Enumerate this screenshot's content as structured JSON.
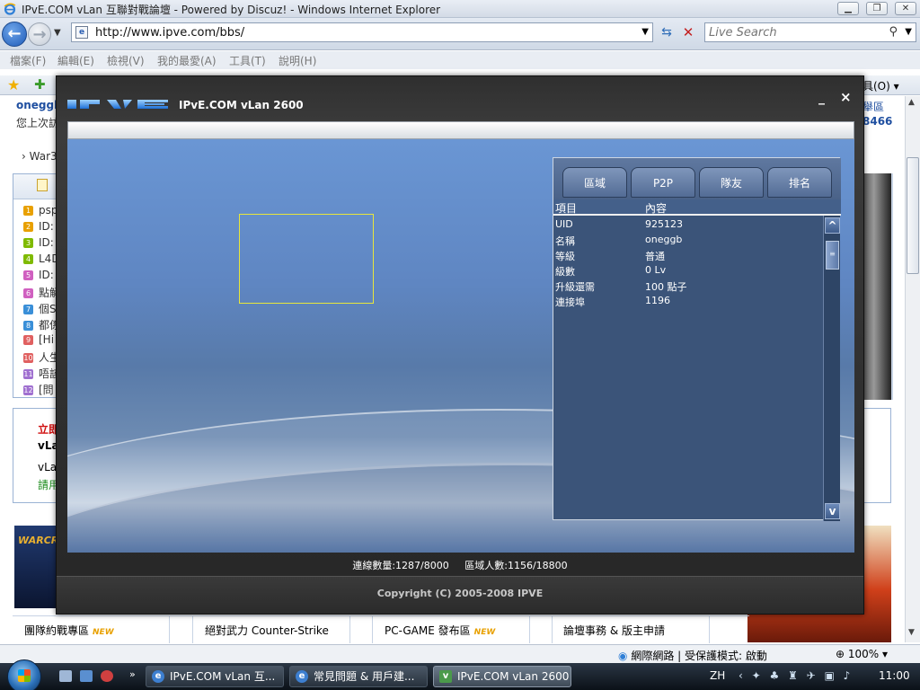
{
  "browser": {
    "window_title": "IPvE.COM vLan 互聯對戰論壇 - Powered by Discuz! - Windows Internet Explorer",
    "url": "http://www.ipve.com/bbs/",
    "search_placeholder": "Live Search",
    "menu": [
      "檔案(F)",
      "編輯(E)",
      "檢視(V)",
      "我的最愛(A)",
      "工具(T)",
      "說明(H)"
    ],
    "tools_label": "具(O)",
    "status_zone": "網際網路 | 受保護模式: 啟動",
    "zoom": "100%"
  },
  "webpage": {
    "username": "oneggb",
    "last_visit": "您上次訪",
    "breadcrumb": "War3",
    "list_items": [
      "psp",
      "ID:",
      "ID:",
      "L4D",
      "ID:",
      "點解",
      "個S",
      "都係",
      "[Hi",
      "人生",
      "唔該",
      "[問"
    ],
    "list_num_colors": [
      "#e8a000",
      "#e8a000",
      "#7fba00",
      "#7fba00",
      "#d060c0",
      "#d060c0",
      "#3a8fd8",
      "#3a8fd8",
      "#e06060",
      "#e06060",
      "#a070d0",
      "#a070d0"
    ],
    "notice_red": "立即",
    "notice_bold": "vLa",
    "notice_text": "vLa",
    "notice_link": "請用",
    "side_link": "舉區",
    "side_number": "8466",
    "bottom_row": [
      "團隊約戰專區",
      "絕對武力 Counter-Strike",
      "PC-GAME 發布區",
      "論壇事務 & 版主申請"
    ],
    "new_label": "NEW"
  },
  "taskbar": {
    "buttons": [
      "IPvE.COM vLan 互...",
      "常見問題 & 用戶建...",
      "IPvE.COM vLan 2600"
    ],
    "lang": "ZH",
    "clock": "11:00"
  },
  "app": {
    "logo_text": "IPVE",
    "title": "IPvE.COM vLan 2600",
    "tabs": [
      "區域",
      "P2P",
      "隊友",
      "排名"
    ],
    "columns": [
      "項目",
      "內容"
    ],
    "rows": [
      {
        "key": "UID",
        "value": "925123"
      },
      {
        "key": "名稱",
        "value": "oneggb"
      },
      {
        "key": "等級",
        "value": "普通"
      },
      {
        "key": "級數",
        "value": "0 Lv"
      },
      {
        "key": "升級還需",
        "value": "100 點子"
      },
      {
        "key": "連接埠",
        "value": "1196"
      }
    ],
    "status_connections": "連線數量:1287/8000",
    "status_region": "區域人數:1156/18800",
    "copyright": "Copyright (C) 2005-2008 IPVE"
  },
  "colors": {
    "app_panel_bg": "#3b5479",
    "app_main_blue": "#6a96d4",
    "preview_border": "#e8e63a"
  }
}
